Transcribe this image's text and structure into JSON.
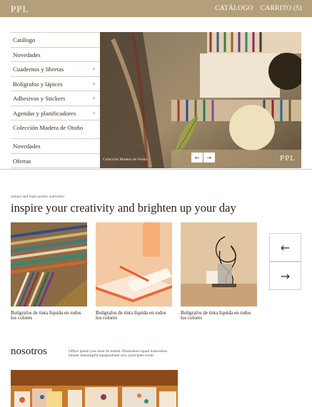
{
  "header": {
    "logo": "PPL",
    "nav": [
      "CATÁLOGO",
      "CARRITO (5)"
    ]
  },
  "menu": [
    {
      "label": "Catálogo",
      "plus": ""
    },
    {
      "label": "Novedades",
      "plus": ""
    },
    {
      "label": "Cuadernos y libretas",
      "plus": "+"
    },
    {
      "label": "Bolígrafos y lápices",
      "plus": "+"
    },
    {
      "label": "Adhesivos y Stickers",
      "plus": "+"
    },
    {
      "label": "Agendas y planificadores",
      "plus": "+"
    },
    {
      "label": "Colección Madera de Otoño",
      "plus": ""
    },
    {
      "label": "Novedades",
      "plus": ""
    },
    {
      "label": "Ofertas",
      "plus": ""
    }
  ],
  "hero": {
    "caption": "Colección  Madera de Otoño",
    "prev": "←",
    "next": "→",
    "logo": "PPL"
  },
  "inspire": {
    "kicker": "unique and high-quality stationery",
    "heading": "inspire your creativity and brighten up your day",
    "cards": [
      {
        "caption": "Bolígrafos de tinta líquida en todos los colores"
      },
      {
        "caption": "Bolígrafos de tinta líquida en todos los colores"
      },
      {
        "caption": "Bolígrafos de tinta líquida en todos los colores"
      }
    ],
    "prev": "←",
    "next": "→"
  },
  "about": {
    "title": "nosotros",
    "text": "Office ipsum you must be muted. Illustration squad innovation banner meaningful marginalised sexy principles event."
  }
}
